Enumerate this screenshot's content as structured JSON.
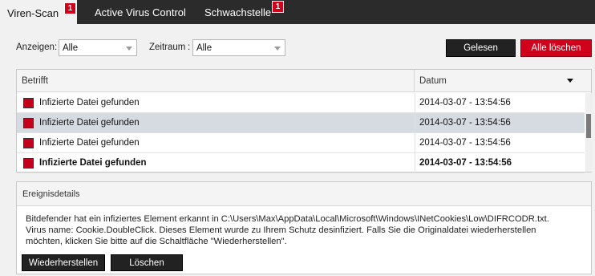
{
  "tabs": [
    {
      "label": "Viren-Scan",
      "badge": "1",
      "active": true
    },
    {
      "label": "Active Virus Control",
      "active": false
    },
    {
      "label": "Schwachstelle",
      "badge": "1",
      "active": false
    }
  ],
  "filters": {
    "show_label": "Anzeigen",
    "show_value": "Alle",
    "period_label": "Zeitraum",
    "period_value": "Alle"
  },
  "actions": {
    "read_label": "Gelesen",
    "delete_all_label": "Alle löschen"
  },
  "table": {
    "columns": [
      "Betrifft",
      "Datum"
    ],
    "sort_column": "Datum",
    "rows": [
      {
        "subject": "Infizierte Datei gefunden",
        "date": "2014-03-07 - 13:54:56",
        "selected": false,
        "bold": false
      },
      {
        "subject": "Infizierte Datei gefunden",
        "date": "2014-03-07 - 13:54:56",
        "selected": true,
        "bold": false
      },
      {
        "subject": "Infizierte Datei gefunden",
        "date": "2014-03-07 - 13:54:56",
        "selected": false,
        "bold": false
      },
      {
        "subject": "Infizierte Datei gefunden",
        "date": "2014-03-07 - 13:54:56",
        "selected": false,
        "bold": true
      }
    ]
  },
  "details": {
    "title": "Ereignisdetails",
    "lines": [
      "Bitdefender hat ein infiziertes Element erkannt in C:\\Users\\Max\\AppData\\Local\\Microsoft\\Windows\\INetCookies\\Low\\DIFRCODR.txt.",
      "Virus name: Cookie.DoubleClick. Dieses Element wurde zu Ihrem Schutz desinfiziert. Falls Sie die Originaldatei wiederherstellen",
      "möchten, klicken Sie bitte auf die Schaltfläche \"Wiederherstellen\"."
    ],
    "restore_label": "Wiederherstellen",
    "delete_label": "Löschen"
  },
  "colors": {
    "accent_red": "#d0021b",
    "tabbar_bg": "#2b2b2b",
    "selected_row": "#d6dbe1"
  }
}
